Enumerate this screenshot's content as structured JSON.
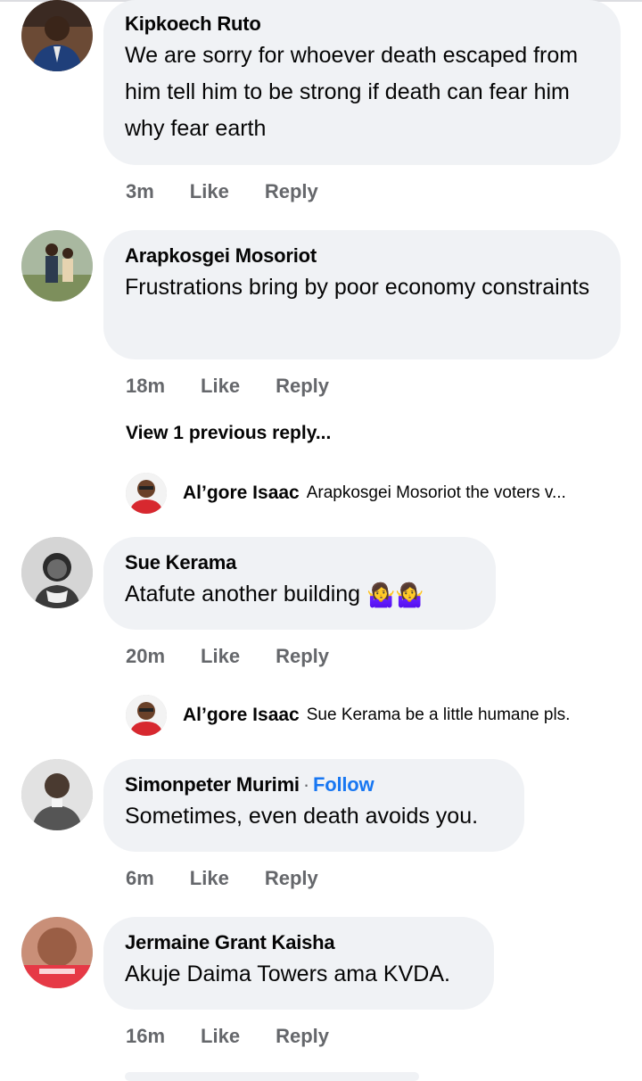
{
  "comments": [
    {
      "author": "Kipkoech Ruto",
      "text": "We are sorry for whoever death escaped from him tell him to be strong if death can fear him why fear earth",
      "time": "3m",
      "like": "Like",
      "reply": "Reply"
    },
    {
      "author": "Arapkosgei Mosoriot",
      "text": "Frustrations bring by poor economy constraints",
      "time": "18m",
      "like": "Like",
      "reply": "Reply",
      "view_previous": "View 1 previous reply...",
      "reply_preview": {
        "author": "Al’gore Isaac",
        "text": "Arapkosgei Mosoriot the voters v..."
      }
    },
    {
      "author": "Sue Kerama",
      "text": "Atafute another building",
      "emoji": "🤷‍♀️🤷‍♀️",
      "time": "20m",
      "like": "Like",
      "reply": "Reply",
      "reply_preview": {
        "author": "Al’gore Isaac",
        "text": "Sue Kerama be a little humane pls."
      }
    },
    {
      "author": "Simonpeter Murimi",
      "follow": "Follow",
      "separator": "·",
      "text": "Sometimes, even death avoids you.",
      "time": "6m",
      "like": "Like",
      "reply": "Reply"
    },
    {
      "author": "Jermaine Grant Kaisha",
      "text": "Akuje Daima Towers ama KVDA.",
      "time": "16m",
      "like": "Like",
      "reply": "Reply"
    }
  ],
  "colors": {
    "bubble": "#f0f2f5",
    "meta": "#65676b",
    "follow": "#1877f2"
  }
}
